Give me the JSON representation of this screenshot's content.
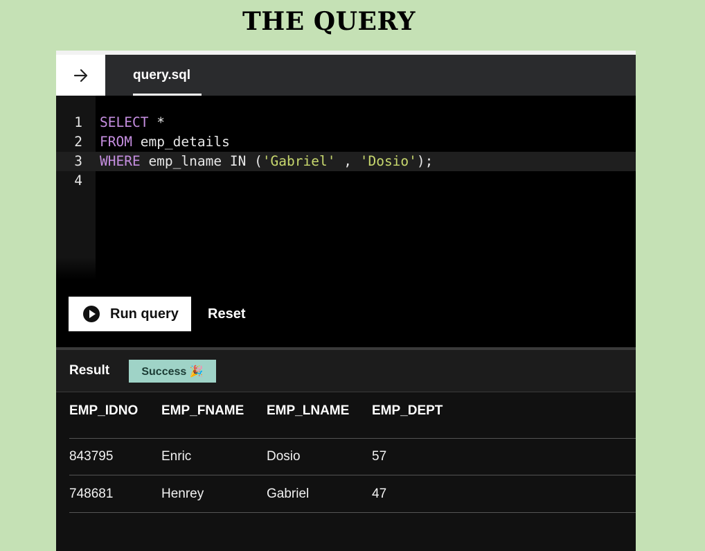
{
  "page": {
    "title": "THE QUERY"
  },
  "tabbar": {
    "back_icon": "arrow-right-icon",
    "tab_label": "query.sql"
  },
  "editor": {
    "lines": [
      {
        "number": "1",
        "parts": [
          {
            "t": "SELECT",
            "k": "kw"
          },
          {
            "t": " *",
            "k": "plain"
          }
        ]
      },
      {
        "number": "2",
        "parts": [
          {
            "t": "FROM",
            "k": "kw"
          },
          {
            "t": " emp_details",
            "k": "plain"
          }
        ]
      },
      {
        "number": "3",
        "parts": [
          {
            "t": "WHERE",
            "k": "kw"
          },
          {
            "t": " emp_lname IN (",
            "k": "plain"
          },
          {
            "t": "'Gabriel'",
            "k": "str"
          },
          {
            "t": " , ",
            "k": "plain"
          },
          {
            "t": "'Dosio'",
            "k": "str"
          },
          {
            "t": ");",
            "k": "plain"
          }
        ]
      },
      {
        "number": "4",
        "parts": []
      }
    ],
    "active_line": 3
  },
  "actions": {
    "run_label": "Run query",
    "reset_label": "Reset",
    "run_icon": "play-icon"
  },
  "result": {
    "label": "Result",
    "status": "Success 🎉",
    "columns": [
      "EMP_IDNO",
      "EMP_FNAME",
      "EMP_LNAME",
      "EMP_DEPT"
    ],
    "rows": [
      [
        "843795",
        "Enric",
        "Dosio",
        "57"
      ],
      [
        "748681",
        "Henrey",
        "Gabriel",
        "47"
      ]
    ]
  },
  "colors": {
    "background": "#c5e1b5",
    "keyword": "#c58ee0",
    "string": "#c8d86e",
    "badge": "#9fd3c7"
  }
}
